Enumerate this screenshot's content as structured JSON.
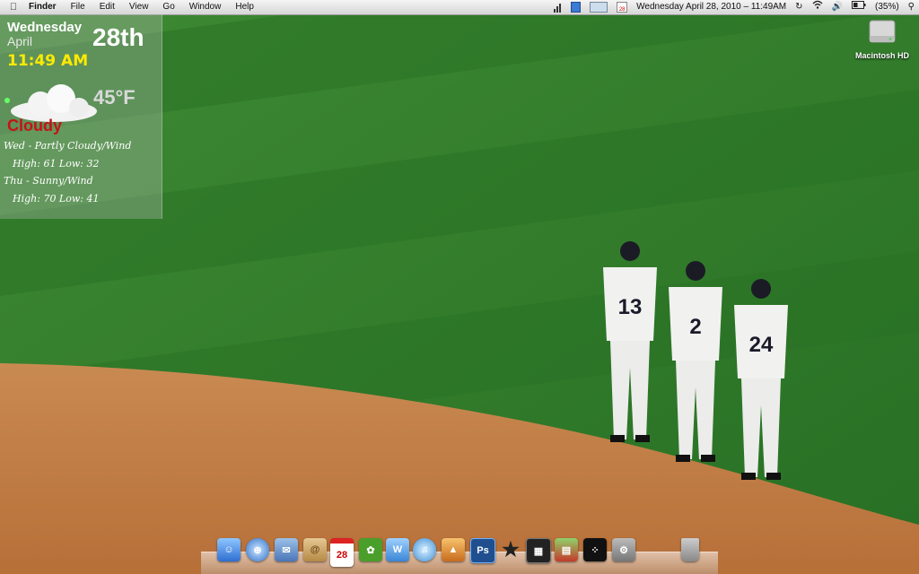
{
  "menubar": {
    "menus": [
      "Finder",
      "File",
      "Edit",
      "View",
      "Go",
      "Window",
      "Help"
    ],
    "cal_icon": "28",
    "clock": "Wednesday  April 28, 2010 – 11:49AM",
    "battery": "(35%)"
  },
  "widget": {
    "day": "Wednesday",
    "month": "April",
    "date": "28th",
    "time": "11:49 AM",
    "temp": "45°F",
    "condition": "Cloudy",
    "forecast": [
      {
        "line1": "Wed - Partly Cloudy/Wind",
        "line2": "High: 61   Low: 32"
      },
      {
        "line1": "Thu - Sunny/Wind",
        "line2": "High: 70   Low: 41"
      }
    ]
  },
  "desktop": {
    "disk_label": "Macintosh HD"
  },
  "players": [
    "13",
    "2",
    "24"
  ],
  "dock": {
    "items": [
      "finder-icon",
      "safari-icon",
      "mail-icon",
      "address-book-icon",
      "ical-icon",
      "dreamweaver-icon",
      "word-icon",
      "itunes-icon",
      "iphoto-icon",
      "photoshop-icon",
      "imovie-icon",
      "final-cut-icon",
      "photo-app-icon",
      "blackberry-icon",
      "system-preferences-icon",
      "trash-icon"
    ],
    "ical_date": "28",
    "ps_label": "Ps"
  },
  "colors": {
    "grass": "#2f7a2a",
    "dirt": "#c47d43",
    "time": "#ffea00",
    "condition": "#c41414"
  }
}
